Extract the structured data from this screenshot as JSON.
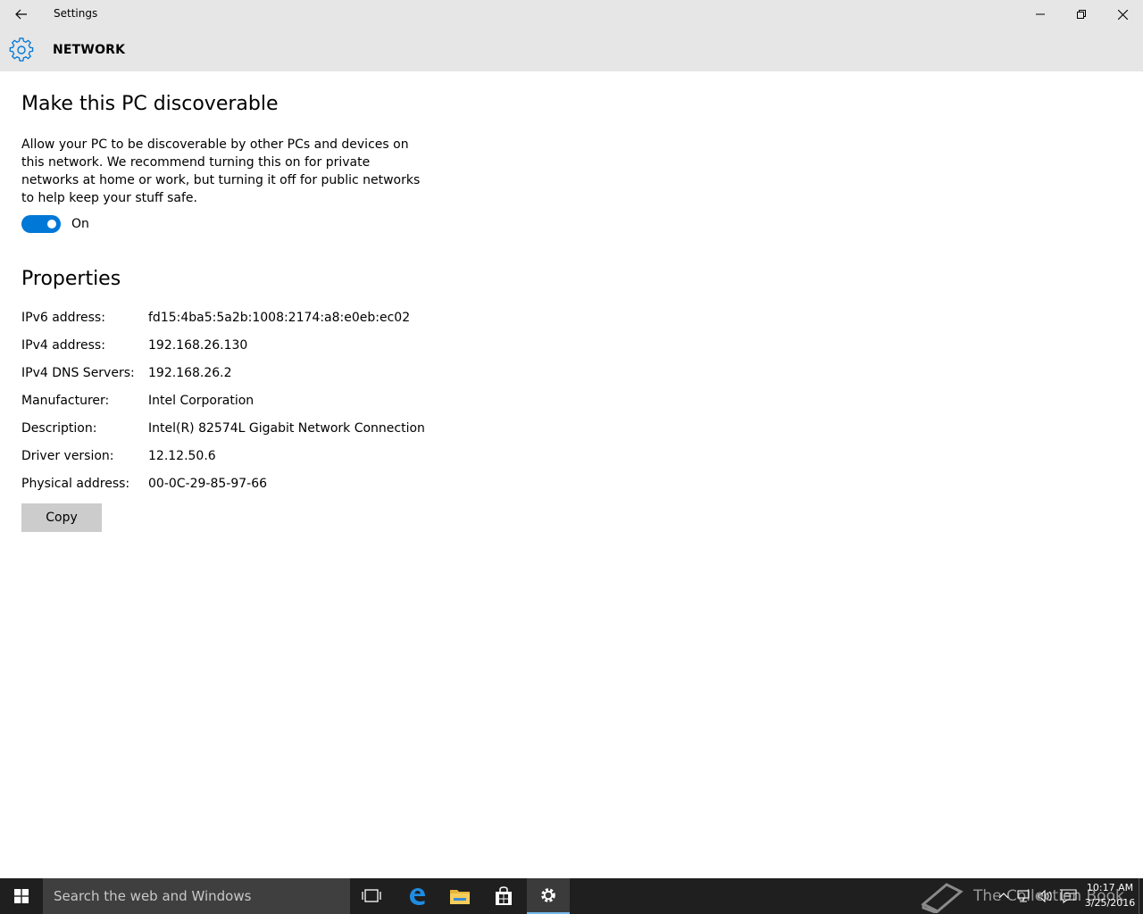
{
  "window": {
    "title": "Settings"
  },
  "header": {
    "title": "NETWORK"
  },
  "discoverable": {
    "heading": "Make this PC discoverable",
    "description": "Allow your PC to be discoverable by other PCs and devices on this network. We recommend turning this on for private networks at home or work, but turning it off for public networks to help keep your stuff safe.",
    "toggle_state": "On"
  },
  "properties": {
    "heading": "Properties",
    "rows": [
      {
        "key": "IPv6 address:",
        "value": "fd15:4ba5:5a2b:1008:2174:a8:e0eb:ec02"
      },
      {
        "key": "IPv4 address:",
        "value": "192.168.26.130"
      },
      {
        "key": "IPv4 DNS Servers:",
        "value": "192.168.26.2"
      },
      {
        "key": "Manufacturer:",
        "value": "Intel Corporation"
      },
      {
        "key": "Description:",
        "value": "Intel(R) 82574L Gigabit Network Connection"
      },
      {
        "key": "Driver version:",
        "value": "12.12.50.6"
      },
      {
        "key": "Physical address:",
        "value": "00-0C-29-85-97-66"
      }
    ],
    "copy_label": "Copy"
  },
  "taskbar": {
    "search_placeholder": "Search the web and Windows",
    "watermark": "The Collection Book",
    "time": "10:17 AM",
    "date": "3/25/2016"
  },
  "colors": {
    "accent": "#0078d7",
    "titlebar": "#e6e6e6",
    "taskbar": "#1f1f1f"
  }
}
